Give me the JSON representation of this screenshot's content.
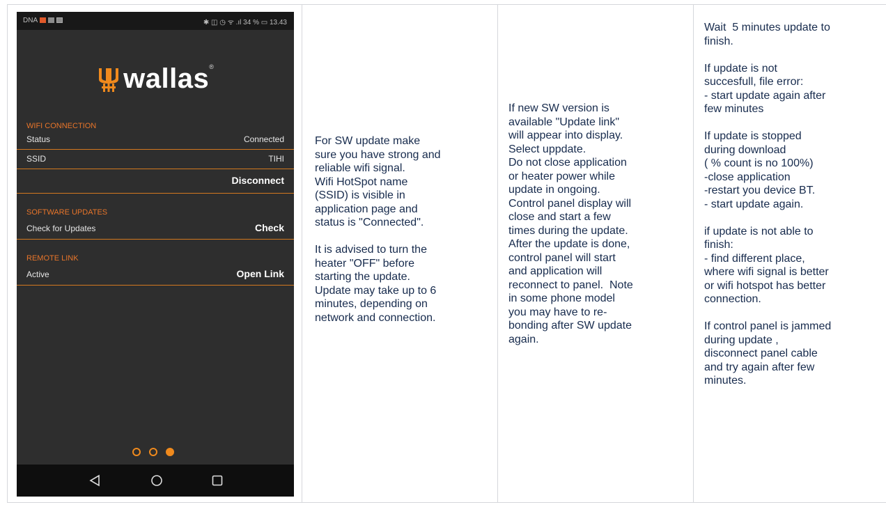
{
  "phone": {
    "status_left": "DNA",
    "status_right": "✱ ◫ ◷ ᯤ .ıl 34 % ▭ 13.43",
    "brand": "wallas",
    "wifi": {
      "section_title": "WIFI CONNECTION",
      "status_label": "Status",
      "status_value": "Connected",
      "ssid_label": "SSID",
      "ssid_value": "TIHI",
      "disconnect": "Disconnect"
    },
    "software": {
      "section_title": "SOFTWARE UPDATES",
      "check_label": "Check for Updates",
      "check_button": "Check"
    },
    "remote": {
      "section_title": "REMOTE LINK",
      "active_label": "Active",
      "open_button": "Open Link"
    },
    "page_indicator": {
      "count": 3,
      "active": 3
    },
    "icons": [
      "back-icon",
      "home-icon",
      "recents-icon"
    ],
    "accent_color": "#f08a1d"
  },
  "col2_text": "For SW update make\nsure you have strong and\nreliable wifi signal.\nWifi HotSpot name\n(SSID) is visible in\napplication page and\nstatus is \"Connected\".\n\nIt is advised to turn the\nheater \"OFF\" before\nstarting the update.\nUpdate may take up to 6\nminutes, depending on\nnetwork and connection.",
  "col3_text": "If new SW version is\navailable \"Update link\"\nwill appear into display.\nSelect uppdate.\nDo not close application\nor heater power while\nupdate in ongoing.\nControl panel display will\nclose and start a few\ntimes during the update.\nAfter the update is done,\ncontrol panel will start\nand application will\nreconnect to panel.  Note\nin some phone model\nyou may have to re-\nbonding after SW update\nagain.",
  "col4_text": "Wait  5 minutes update to\nfinish.\n\nIf update is not\nsuccesfull, file error:\n- start update again after\nfew minutes\n\nIf update is stopped\nduring download\n( % count is no 100%)\n-close application\n-restart you device BT.\n- start update again.\n\nif update is not able to\nfinish:\n- find different place,\nwhere wifi signal is better\nor wifi hotspot has better\nconnection.\n\nIf control panel is jammed\nduring update ,\ndisconnect panel cable\nand try again after few\nminutes."
}
